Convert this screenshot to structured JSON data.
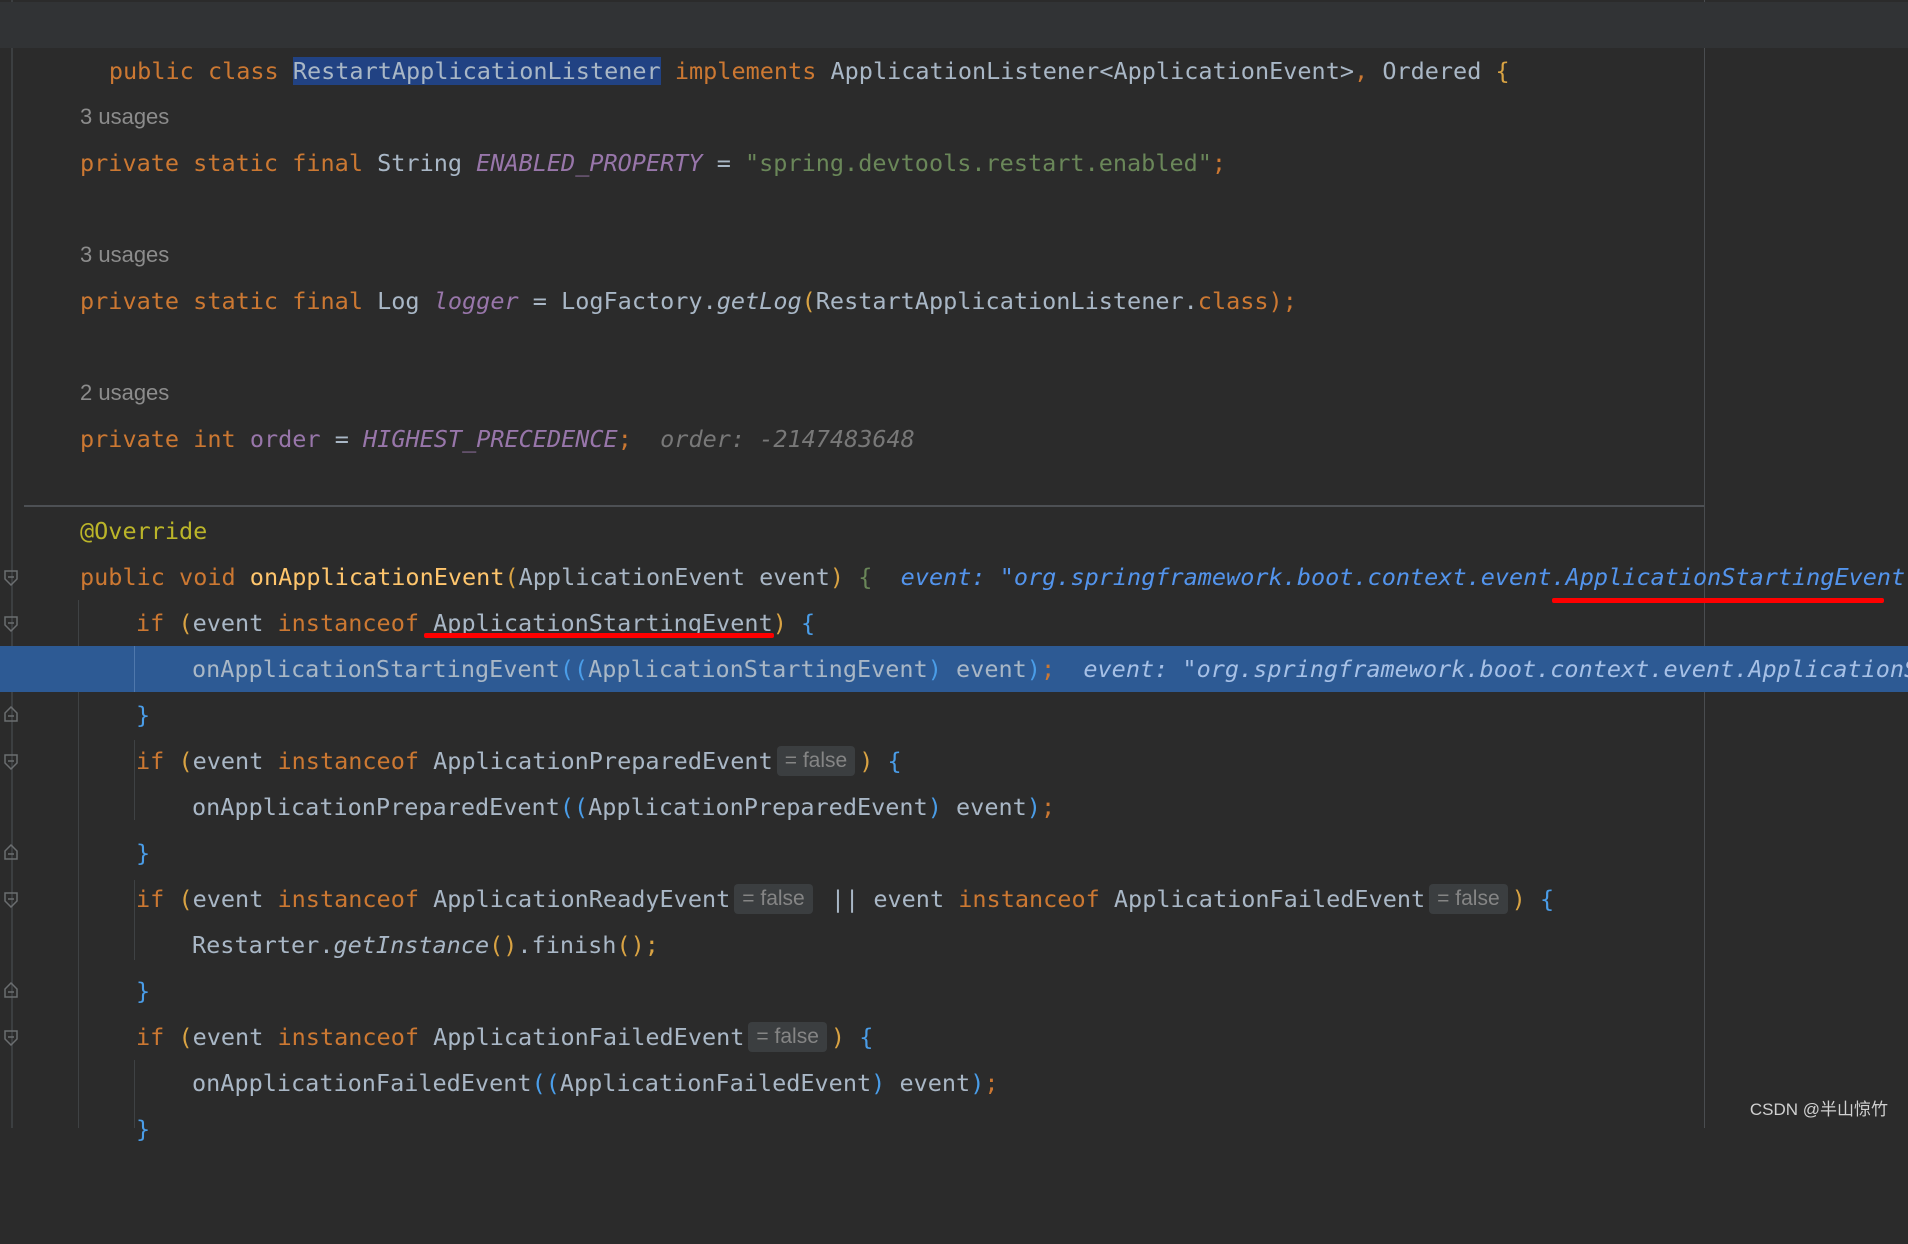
{
  "header": {
    "kw_public": "public",
    "kw_class": "class",
    "class_name": "RestartApplicationListener",
    "kw_implements": "implements",
    "iface_1": "ApplicationListener",
    "iface_1_generic": "<ApplicationEvent>",
    "comma": ",",
    "iface_2": "Ordered",
    "brace": "{"
  },
  "fields": [
    {
      "usages": "3 usages",
      "mods": "private static final",
      "type": "String",
      "name": "ENABLED_PROPERTY",
      "eq": "=",
      "value": "\"spring.devtools.restart.enabled\"",
      "semi": ";"
    },
    {
      "usages": "3 usages",
      "mods": "private static final",
      "type": "Log",
      "name": "logger",
      "eq": "=",
      "call_obj": "LogFactory.",
      "call_method": "getLog",
      "arg": "RestartApplicationListener.",
      "arg_kw": "class",
      "semi": ");"
    },
    {
      "usages": "2 usages",
      "mods": "private",
      "type": "int",
      "name": "order",
      "eq": "=",
      "value": "HIGHEST_PRECEDENCE",
      "semi": ";",
      "hint": "order: -2147483648"
    }
  ],
  "method": {
    "annotation": "@Override",
    "mods": "public",
    "ret": "void",
    "name": "onApplicationEvent",
    "param_type": "ApplicationEvent",
    "param_name": "event",
    "brace": "{",
    "debug_hint": "event: \"org.springframework.boot.context.event.ApplicationStartingEvent[s"
  },
  "blocks": [
    {
      "kw_if": "if",
      "cond_var": "event",
      "kw_instanceof": "instanceof",
      "cond_type": "ApplicationStartingEvent",
      "inlay": "",
      "body_call": "onApplicationStartingEvent",
      "body_cast": "ApplicationStartingEvent",
      "body_arg": "event",
      "body_hint": "event: \"org.springframework.boot.context.event.ApplicationS"
    },
    {
      "kw_if": "if",
      "cond_var": "event",
      "kw_instanceof": "instanceof",
      "cond_type": "ApplicationPreparedEvent",
      "inlay": "= false",
      "body_call": "onApplicationPreparedEvent",
      "body_cast": "ApplicationPreparedEvent",
      "body_arg": "event"
    },
    {
      "kw_if": "if",
      "cond_var": "event",
      "kw_instanceof": "instanceof",
      "cond_type": "ApplicationReadyEvent",
      "inlay": "= false",
      "or": "||",
      "cond_var_2": "event",
      "kw_instanceof_2": "instanceof",
      "cond_type_2": "ApplicationFailedEvent",
      "inlay_2": "= false",
      "body_obj": "Restarter.",
      "body_method": "getInstance",
      "body_rest": ".finish",
      "body_end": "();"
    },
    {
      "kw_if": "if",
      "cond_var": "event",
      "kw_instanceof": "instanceof",
      "cond_type": "ApplicationFailedEvent",
      "inlay": "= false",
      "body_call": "onApplicationFailedEvent",
      "body_cast": "ApplicationFailedEvent",
      "body_arg": "event"
    }
  ],
  "closing_brace": "}",
  "watermark": "CSDN @半山惊竹",
  "colors": {
    "background": "#2b2b2b",
    "keyword": "#cc7832",
    "method": "#ffc66d",
    "string": "#6a8759",
    "field": "#9876aa",
    "annotation": "#bbb529",
    "execution_line": "#2d5a94",
    "annotation_underline": "#ff0000"
  }
}
